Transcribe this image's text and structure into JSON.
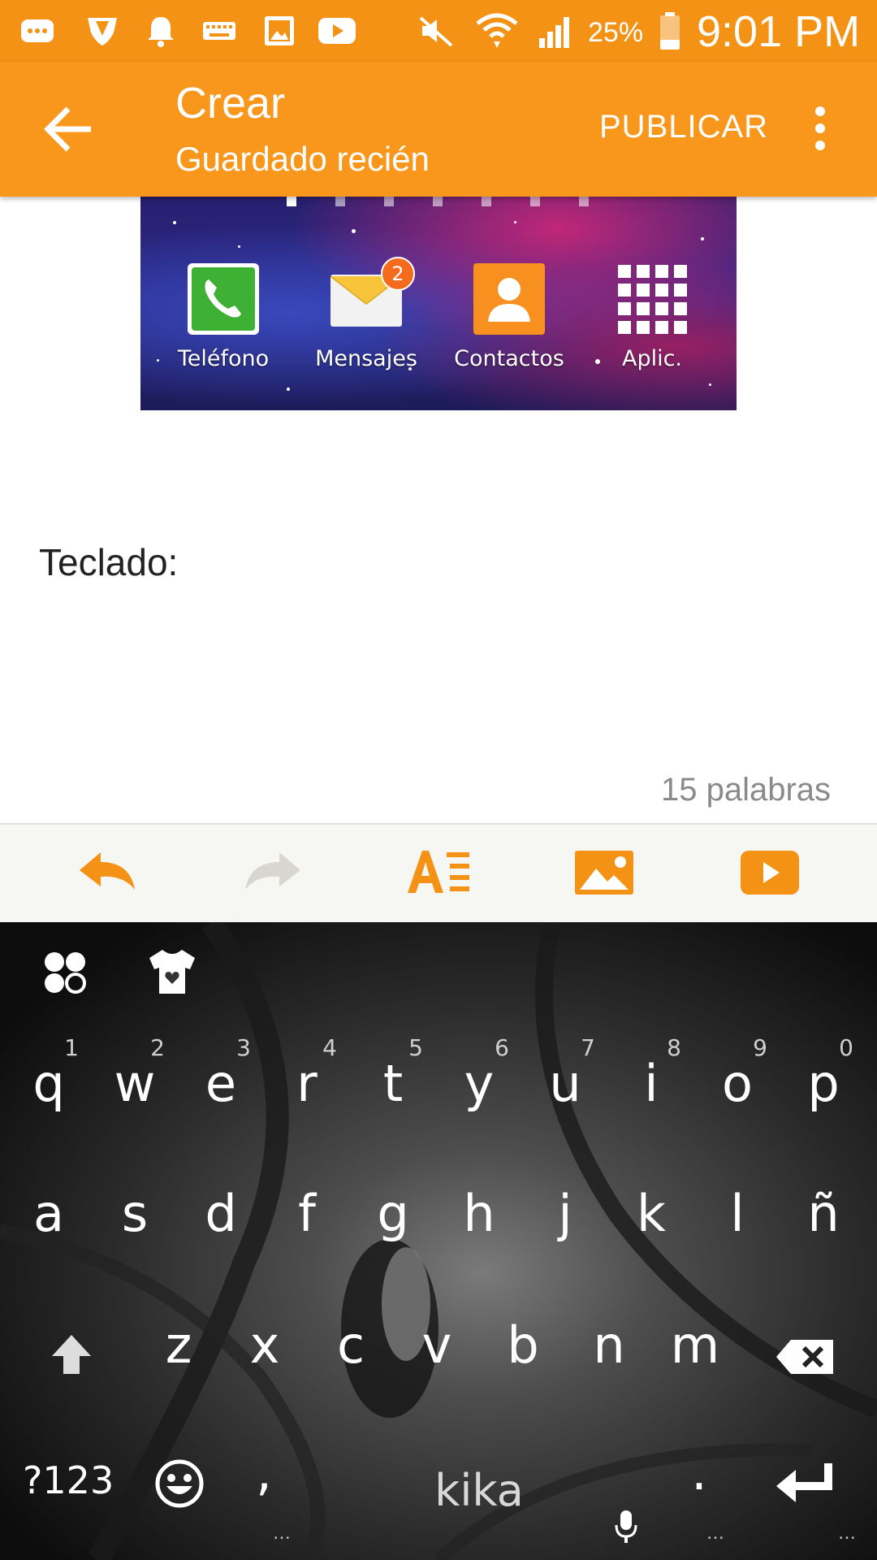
{
  "status_bar": {
    "battery_percent": "25%",
    "time": "9:01 PM",
    "icons": [
      "messages-icon",
      "shield-icon",
      "bell-icon",
      "keyboard-icon",
      "image-icon",
      "youtube-icon",
      "mute-icon",
      "wifi-icon",
      "signal-icon",
      "battery-icon"
    ]
  },
  "app_bar": {
    "title": "Crear",
    "subtitle": "Guardado recién",
    "publish_label": "PUBLICAR"
  },
  "embedded_screenshot": {
    "apps": [
      {
        "label": "Teléfono",
        "icon": "phone-icon"
      },
      {
        "label": "Mensajes",
        "icon": "mail-icon",
        "badge": "2"
      },
      {
        "label": "Contactos",
        "icon": "contacts-icon"
      },
      {
        "label": "Aplic.",
        "icon": "apps-grid-icon"
      }
    ]
  },
  "body": {
    "text": "Teclado:",
    "word_count": "15 palabras"
  },
  "toolbar": {
    "items": [
      "undo-icon",
      "redo-icon",
      "text-format-icon",
      "insert-image-icon",
      "insert-video-icon"
    ]
  },
  "keyboard": {
    "row1": [
      "q",
      "w",
      "e",
      "r",
      "t",
      "y",
      "u",
      "i",
      "o",
      "p"
    ],
    "row1_hints": [
      "1",
      "2",
      "3",
      "4",
      "5",
      "6",
      "7",
      "8",
      "9",
      "0"
    ],
    "row2": [
      "a",
      "s",
      "d",
      "f",
      "g",
      "h",
      "j",
      "k",
      "l",
      "ñ"
    ],
    "row3": [
      "z",
      "x",
      "c",
      "v",
      "b",
      "n",
      "m"
    ],
    "symbols_label": "?123",
    "comma": ",",
    "space_label": "kika",
    "period": "."
  },
  "colors": {
    "status_bar": "#F39214",
    "app_bar": "#F8971C",
    "accent": "#F39214"
  }
}
